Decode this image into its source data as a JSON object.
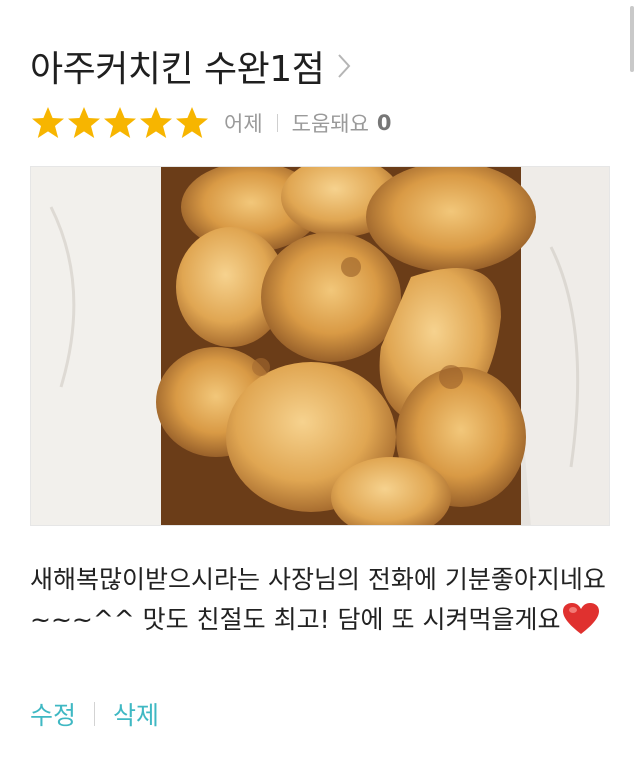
{
  "review": {
    "title": "아주커치킨 수완1점",
    "rating": 5,
    "rating_max": 5,
    "date": "어제",
    "helpful_label": "도움돼요",
    "helpful_count": "0",
    "text": "새해복많이받으시라는 사장님의 전화에 기분좋아지네요~~~^^ 맛도 친절도 최고! 담에 또 시켜먹을게요",
    "heart_icon": "red-heart-icon",
    "photo_subject": "fried-chicken-photo"
  },
  "actions": {
    "edit": "수정",
    "delete": "삭제"
  },
  "colors": {
    "star": "#f7b500",
    "accent": "#3fb8c3",
    "heart": "#e0312f",
    "muted": "#9a9a9a"
  }
}
